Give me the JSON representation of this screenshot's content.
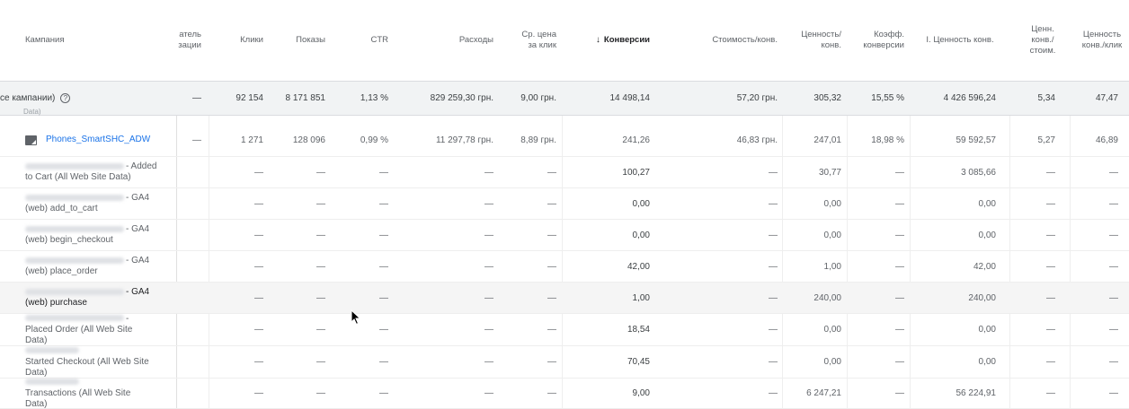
{
  "columns": [
    {
      "key": "campaign",
      "label": "Кампания"
    },
    {
      "key": "opt",
      "label_line1": "атель",
      "label_line2": "зации"
    },
    {
      "key": "clicks",
      "label": "Клики"
    },
    {
      "key": "impr",
      "label": "Показы"
    },
    {
      "key": "ctr",
      "label": "CTR"
    },
    {
      "key": "cost",
      "label": "Расходы"
    },
    {
      "key": "cpc",
      "label_line1": "Ср. цена",
      "label_line2": "за клик"
    },
    {
      "key": "conv",
      "label": "Конверсии",
      "sort_icon": "arrow-down-icon"
    },
    {
      "key": "cost_conv",
      "label": "Стоимость/конв."
    },
    {
      "key": "value_conv",
      "label_line1": "Ценность/",
      "label_line2": "конв."
    },
    {
      "key": "conv_rate",
      "label_line1": "Коэфф.",
      "label_line2": "конверсии"
    },
    {
      "key": "conv_value",
      "label": "I. Ценность конв."
    },
    {
      "key": "value_cost",
      "label_line1": "Ценн.",
      "label_line2": "конв./",
      "label_line3": "стоим."
    },
    {
      "key": "value_click",
      "label_line1": "Ценность",
      "label_line2": "конв./клик"
    }
  ],
  "total": {
    "label": "се кампании)",
    "help_icon": "help-circle-icon",
    "cut_text": "Data)",
    "values": [
      "—",
      "92 154",
      "8 171 851",
      "1,13 %",
      "829 259,30 грн.",
      "9,00 грн.",
      "14 498,14",
      "57,20 грн.",
      "305,32",
      "15,55 %",
      "4 426 596,24",
      "5,34",
      "47,47"
    ]
  },
  "campaign": {
    "icon": "campaign-icon",
    "name": "Phones_SmartSHC_ADW",
    "values": [
      "—",
      "1 271",
      "128 096",
      "0,99 %",
      "11 297,78 грн.",
      "8,89 грн.",
      "241,26",
      "46,83 грн.",
      "247,01",
      "18,98 %",
      "59 592,57",
      "5,27",
      "46,89"
    ]
  },
  "rows": [
    {
      "line1": "- Added",
      "line2": "to Cart (All Web Site Data)",
      "values": [
        "",
        "—",
        "—",
        "—",
        "—",
        "—",
        "100,27",
        "—",
        "30,77",
        "—",
        "3 085,66",
        "—",
        "—"
      ]
    },
    {
      "line1": "- GA4",
      "line2": "(web) add_to_cart",
      "values": [
        "",
        "—",
        "—",
        "—",
        "—",
        "—",
        "0,00",
        "—",
        "0,00",
        "—",
        "0,00",
        "—",
        "—"
      ]
    },
    {
      "line1": "- GA4",
      "line2": "(web) begin_checkout",
      "values": [
        "",
        "—",
        "—",
        "—",
        "—",
        "—",
        "0,00",
        "—",
        "0,00",
        "—",
        "0,00",
        "—",
        "—"
      ]
    },
    {
      "line1": "- GA4",
      "line2": "(web) place_order",
      "values": [
        "",
        "—",
        "—",
        "—",
        "—",
        "—",
        "42,00",
        "—",
        "1,00",
        "—",
        "42,00",
        "—",
        "—"
      ]
    },
    {
      "line1": "- GA4",
      "line2": "(web) purchase",
      "values": [
        "",
        "—",
        "—",
        "—",
        "—",
        "—",
        "1,00",
        "—",
        "240,00",
        "—",
        "240,00",
        "—",
        "—"
      ]
    },
    {
      "line1": "-",
      "line2": "Placed Order (All Web Site",
      "line3": "Data)",
      "values": [
        "",
        "—",
        "—",
        "—",
        "—",
        "—",
        "18,54",
        "—",
        "0,00",
        "—",
        "0,00",
        "—",
        "—"
      ]
    },
    {
      "line1": "",
      "line2": "Started Checkout (All Web Site",
      "line3": "Data)",
      "values": [
        "",
        "—",
        "—",
        "—",
        "—",
        "—",
        "70,45",
        "—",
        "0,00",
        "—",
        "0,00",
        "—",
        "—"
      ]
    },
    {
      "line1": "",
      "line2": "Transactions (All Web Site",
      "line3": "Data)",
      "values": [
        "",
        "—",
        "—",
        "—",
        "—",
        "—",
        "9,00",
        "—",
        "6 247,21",
        "—",
        "56 224,91",
        "—",
        "—"
      ]
    }
  ]
}
